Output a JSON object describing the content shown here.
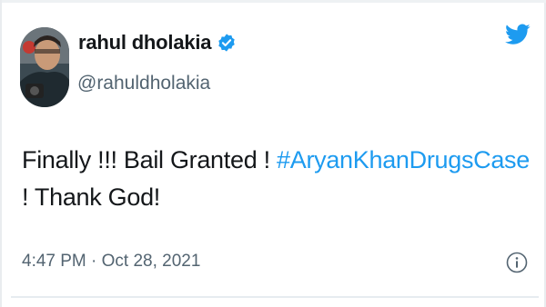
{
  "tweet": {
    "display_name": "rahul dholakia",
    "handle": "@rahuldholakia",
    "text_part1": "Finally !!! Bail Granted ! ",
    "hashtag": "#AryanKhanDrugsCase",
    "text_part2": " ! Thank God!",
    "timestamp": "4:47 PM · Oct 28, 2021"
  },
  "icons": {
    "verified": "verified-badge-icon",
    "brand": "twitter-bird-icon",
    "info": "info-icon"
  },
  "colors": {
    "brand_blue": "#1d9bf0",
    "text": "#14171a",
    "secondary_text": "#536471"
  }
}
